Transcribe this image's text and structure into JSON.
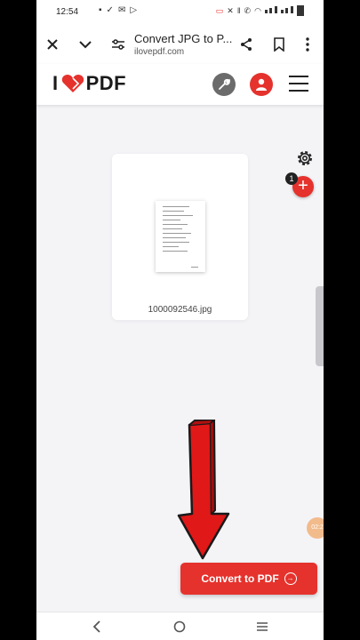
{
  "status": {
    "time": "12:54"
  },
  "browser": {
    "title": "Convert JPG to P...",
    "url": "ilovepdf.com"
  },
  "site": {
    "logo_i": "I",
    "logo_text": "PDF"
  },
  "file": {
    "name": "1000092546.jpg",
    "count_badge": "1"
  },
  "timer": {
    "label": "02:2"
  },
  "actions": {
    "convert_label": "Convert to PDF"
  },
  "colors": {
    "brand": "#e5322d",
    "background": "#f4f4f7",
    "annotation_arrow": "#e01818"
  },
  "icons": [
    "close-icon",
    "chevron-down-icon",
    "tune-icon",
    "share-icon",
    "bookmark-icon",
    "more-vert-icon",
    "wrench-icon",
    "user-icon",
    "hamburger-icon",
    "gear-icon",
    "plus-icon",
    "arrow-circle-right-icon",
    "back-icon",
    "home-icon",
    "recents-icon"
  ]
}
